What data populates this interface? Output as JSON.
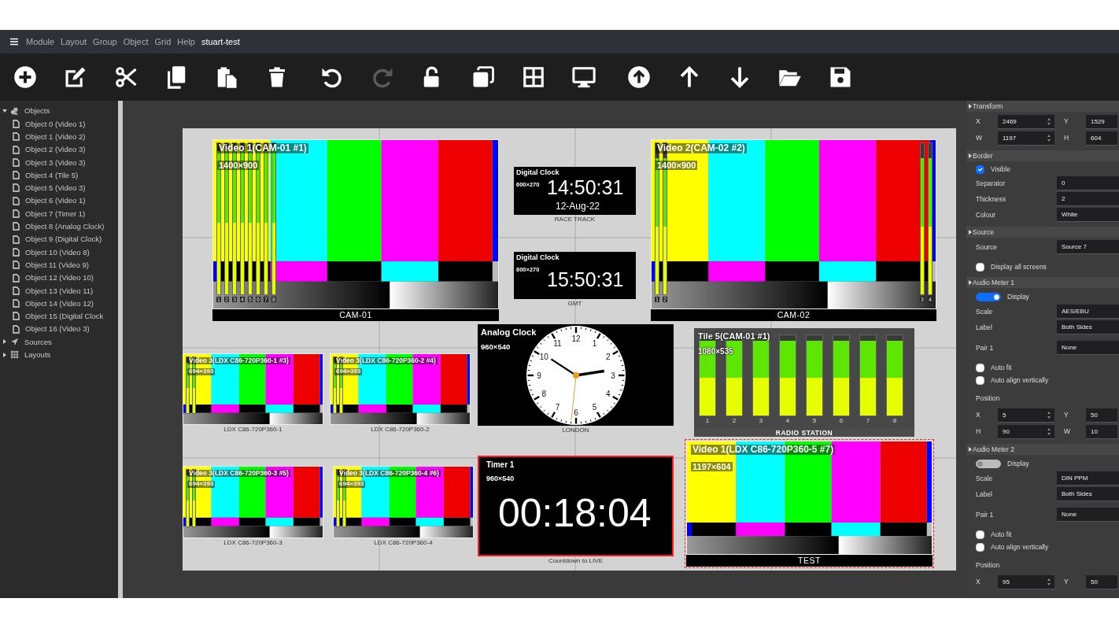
{
  "menu": {
    "items": [
      "Module",
      "Layout",
      "Group",
      "Object",
      "Grid",
      "Help"
    ],
    "title": "stuart-test"
  },
  "toolbar": [
    {
      "kind": "add",
      "disabled": false
    },
    {
      "kind": "edit",
      "disabled": false
    },
    {
      "kind": "cut",
      "disabled": false
    },
    {
      "kind": "copy",
      "disabled": false
    },
    {
      "kind": "paste",
      "disabled": false
    },
    {
      "kind": "delete",
      "disabled": false
    },
    {
      "kind": "undo",
      "disabled": false
    },
    {
      "kind": "redo",
      "disabled": true
    },
    {
      "kind": "unlock",
      "disabled": false
    },
    {
      "kind": "clone",
      "disabled": false
    },
    {
      "kind": "grid",
      "disabled": false
    },
    {
      "kind": "screen",
      "disabled": false
    },
    {
      "kind": "upload",
      "disabled": false
    },
    {
      "kind": "up",
      "disabled": false
    },
    {
      "kind": "down",
      "disabled": false
    },
    {
      "kind": "open",
      "disabled": false
    },
    {
      "kind": "save",
      "disabled": false
    }
  ],
  "tree": [
    {
      "label": "Objects",
      "kind": "objects",
      "expanded": true,
      "children": [
        {
          "label": "Object 0 (Video 1)"
        },
        {
          "label": "Object 1 (Video 2)"
        },
        {
          "label": "Object 2 (Video 3)"
        },
        {
          "label": "Object 3 (Video 3)"
        },
        {
          "label": "Object 4 (Tile 5)"
        },
        {
          "label": "Object 5 (Video 3)"
        },
        {
          "label": "Object 6 (Video 1)"
        },
        {
          "label": "Object 7 (Timer 1)"
        },
        {
          "label": "Object 8 (Analog Clock)"
        },
        {
          "label": "Object 9 (Digital Clock)"
        },
        {
          "label": "Object 10 (Video 8)"
        },
        {
          "label": "Object 11 (Video 9)"
        },
        {
          "label": "Object 12 (Video 10)"
        },
        {
          "label": "Object 13 (Video 11)"
        },
        {
          "label": "Object 14 (Video 12)"
        },
        {
          "label": "Object 15 (Digital Clock"
        },
        {
          "label": "Object 16 (Video 3)"
        }
      ]
    },
    {
      "label": "Sources",
      "kind": "sources",
      "expanded": false
    },
    {
      "label": "Layouts",
      "kind": "layouts",
      "expanded": false
    }
  ],
  "canvas": {
    "objects": [
      {
        "kind": "video",
        "title": "Video 1(CAM-01 #1)",
        "size": "1400×900",
        "bar_label": "CAM-01",
        "selected": false,
        "left_meters": [
          {
            "label": "1",
            "level": 0.95
          },
          {
            "label": "2",
            "level": 0.95
          },
          {
            "label": "3",
            "level": 0.95
          },
          {
            "label": "4",
            "level": 0.95
          },
          {
            "label": "5",
            "level": 0.95
          },
          {
            "label": "6",
            "level": 0.95
          },
          {
            "label": "7",
            "level": 0.95
          },
          {
            "label": "8",
            "level": 0.95
          }
        ]
      },
      {
        "kind": "digital_clock",
        "title": "Digital Clock",
        "size": "600×270",
        "time": "14:50:31",
        "date": "12-Aug-22",
        "caption": "RACE TRACK",
        "selected": false
      },
      {
        "kind": "digital_clock",
        "title": "Digital Clock",
        "size": "600×270",
        "time": "15:50:31",
        "caption": "GMT",
        "selected": false
      },
      {
        "kind": "video",
        "title": "Video 2(CAM-02 #2)",
        "size": "1400×900",
        "bar_label": "CAM-02",
        "selected": false,
        "left_meters": [
          {
            "label": "1",
            "level": 0.9
          },
          {
            "label": "2",
            "level": 0.9
          }
        ],
        "right_meters": [
          {
            "label": "3",
            "level": 0.9
          },
          {
            "label": "4",
            "level": 0.9
          }
        ]
      },
      {
        "kind": "video",
        "title": "Video 3(LDX C86-720P360-1 #3)",
        "size": "694×393",
        "caption": "LDX C86-720P360-1",
        "selected": false,
        "left_meters": [
          {
            "level": 0.9
          },
          {
            "level": 0.9
          }
        ]
      },
      {
        "kind": "video",
        "title": "Video 3(LDX C86-720P360-2 #4)",
        "size": "694×393",
        "caption": "LDX C86-720P360-2",
        "selected": false,
        "left_meters": [
          {
            "level": 0.9
          },
          {
            "level": 0.9
          }
        ]
      },
      {
        "kind": "analog_clock",
        "title": "Analog Clock",
        "size": "960×540",
        "dial_numbers": [
          "12",
          "1",
          "2",
          "3",
          "4",
          "5",
          "6",
          "7",
          "8",
          "9",
          "10",
          "11"
        ],
        "caption": "LONDON",
        "selected": false
      },
      {
        "kind": "tile",
        "title": "Tile 5(CAM-01 #1)",
        "size": "1080×535",
        "bar_label": "RADIO STATION",
        "selected": false,
        "meters": [
          {
            "label": "1",
            "level": 0.93
          },
          {
            "label": "2",
            "level": 0.93
          },
          {
            "label": "3",
            "level": 0.93
          },
          {
            "label": "4",
            "level": 0.93
          },
          {
            "label": "5",
            "level": 0.93
          },
          {
            "label": "6",
            "level": 0.93
          },
          {
            "label": "7",
            "level": 0.93
          },
          {
            "label": "8",
            "level": 0.93
          }
        ]
      },
      {
        "kind": "video",
        "title": "Video 3(LDX C86-720P360-3 #5)",
        "size": "694×393",
        "caption": "LDX C86-720P360-3",
        "selected": false,
        "left_meters": [
          {
            "level": 0.9
          },
          {
            "level": 0.9
          }
        ]
      },
      {
        "kind": "video",
        "title": "Video 3(LDX C86-720P360-4 #6)",
        "size": "694×393",
        "caption": "LDX C86-720P360-4",
        "selected": false,
        "left_meters": [
          {
            "level": 0.9
          },
          {
            "level": 0.9
          }
        ]
      },
      {
        "kind": "timer",
        "title": "Timer 1",
        "size": "960×540",
        "time": "00:18:04",
        "alert": true,
        "caption": "Countdown to LIVE",
        "selected": false
      },
      {
        "kind": "video",
        "title": "Video 1(LDX C86-720P360-5 #7)",
        "size": "1197×604",
        "bar_label": "TEST",
        "selected": true
      }
    ]
  },
  "properties": {
    "sections": [
      {
        "title": "Transform",
        "rows": [
          {
            "kind": "pair",
            "fields": [
              {
                "label": "X",
                "value": "2469"
              },
              {
                "label": "Y",
                "value": "1529"
              }
            ]
          },
          {
            "kind": "pair",
            "fields": [
              {
                "label": "W",
                "value": "1197"
              },
              {
                "label": "H",
                "value": "604"
              }
            ]
          }
        ]
      },
      {
        "title": "Border",
        "rows": [
          {
            "kind": "check",
            "label": "Visible",
            "checked": true
          },
          {
            "kind": "field",
            "label": "Separator",
            "value": "0"
          },
          {
            "kind": "field",
            "label": "Thickness",
            "value": "2"
          },
          {
            "kind": "field",
            "label": "Colour",
            "value": "White"
          }
        ]
      },
      {
        "title": "Source",
        "rows": [
          {
            "kind": "field",
            "label": "Source",
            "value": "Source 7"
          },
          {
            "kind": "check",
            "label": "Display all screens",
            "checked": false
          }
        ]
      },
      {
        "title": "Audio Meter 1",
        "rows": [
          {
            "kind": "switch",
            "label": "Display",
            "on": true
          },
          {
            "kind": "field",
            "label": "Scale",
            "value": "AES/EBU"
          },
          {
            "kind": "field",
            "label": "Label",
            "value": "Both Sides"
          },
          {
            "kind": "field",
            "label": "Pair 1",
            "value": "None"
          },
          {
            "kind": "check",
            "label": "Auto fit",
            "checked": false
          },
          {
            "kind": "check",
            "label": "Auto align vertically",
            "checked": false
          },
          {
            "kind": "heading",
            "label": "Position"
          },
          {
            "kind": "pair",
            "fields": [
              {
                "label": "X",
                "value": "5"
              },
              {
                "label": "Y",
                "value": "50"
              }
            ]
          },
          {
            "kind": "pair",
            "fields": [
              {
                "label": "H",
                "value": "90"
              },
              {
                "label": "W",
                "value": "10"
              }
            ]
          }
        ]
      },
      {
        "title": "Audio Meter 2",
        "rows": [
          {
            "kind": "switch",
            "label": "Display",
            "on": false
          },
          {
            "kind": "field",
            "label": "Scale",
            "value": "DIN PPM"
          },
          {
            "kind": "field",
            "label": "Label",
            "value": "Both Sides"
          },
          {
            "kind": "field",
            "label": "Pair 1",
            "value": "None"
          },
          {
            "kind": "check",
            "label": "Auto fit",
            "checked": false
          },
          {
            "kind": "check",
            "label": "Auto align vertically",
            "checked": false
          },
          {
            "kind": "heading",
            "label": "Position"
          },
          {
            "kind": "pair",
            "fields": [
              {
                "label": "X",
                "value": "95"
              },
              {
                "label": "Y",
                "value": "50"
              }
            ]
          }
        ]
      }
    ]
  }
}
